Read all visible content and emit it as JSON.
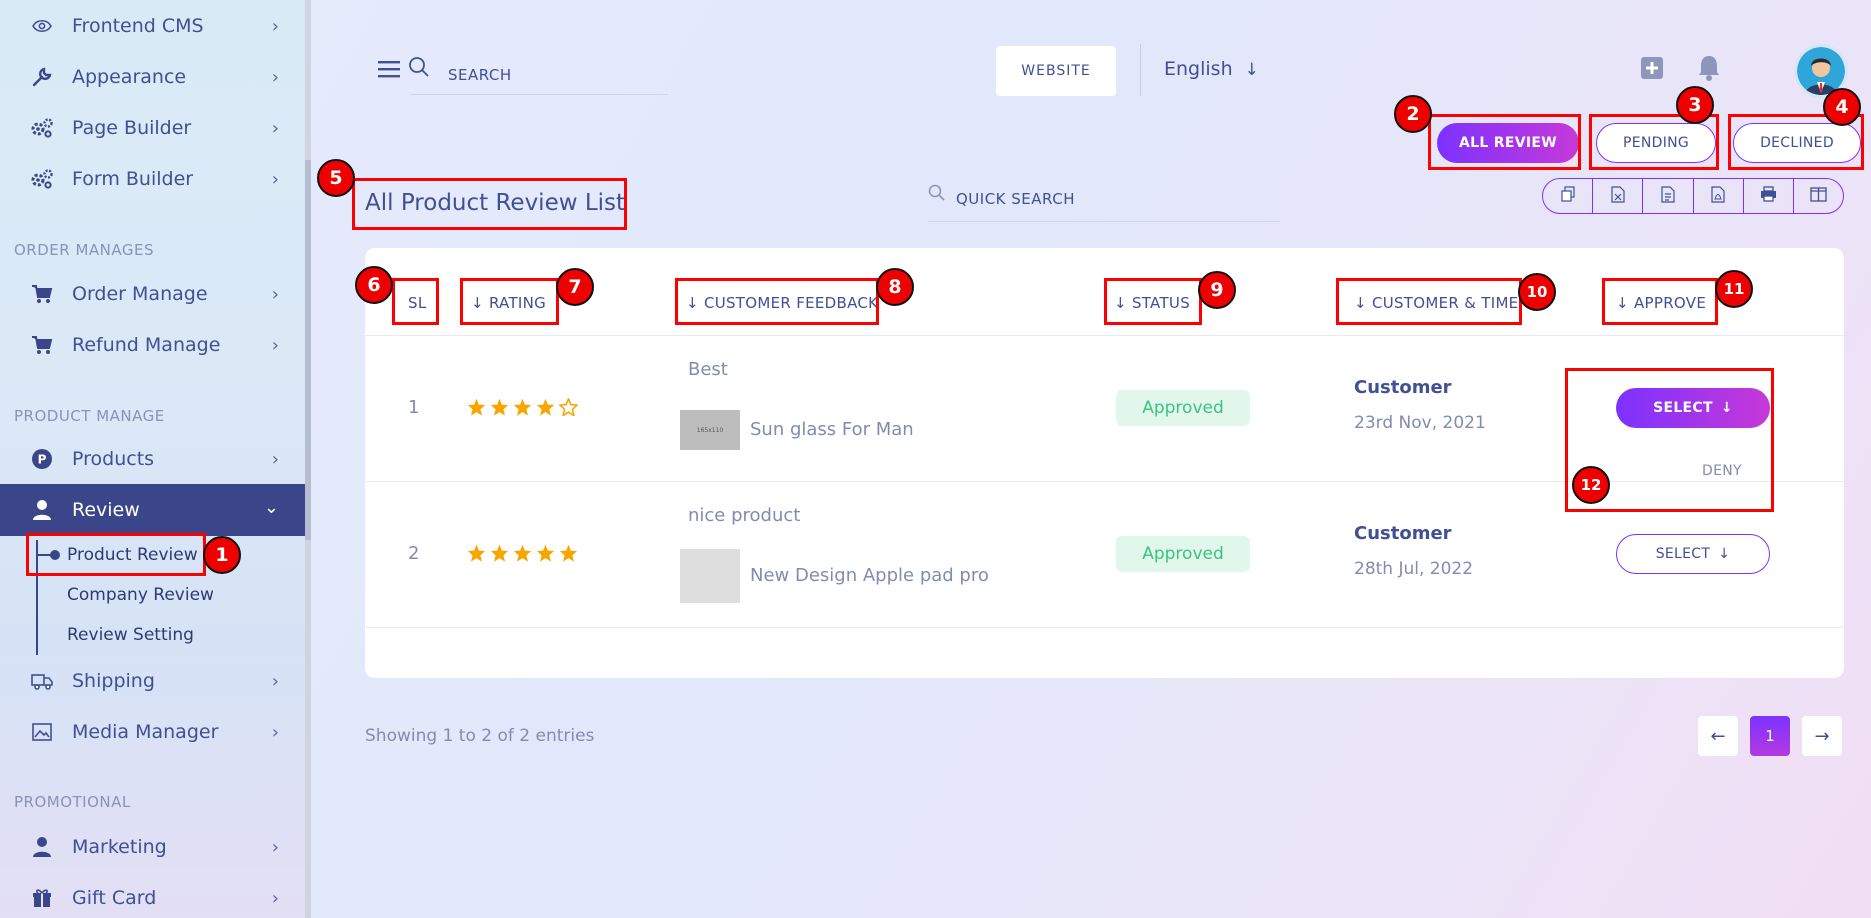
{
  "sidebar": {
    "items": [
      {
        "label": "Frontend CMS",
        "icon": "eye-icon"
      },
      {
        "label": "Appearance",
        "icon": "wrench-icon"
      },
      {
        "label": "Page Builder",
        "icon": "gears-icon"
      },
      {
        "label": "Form Builder",
        "icon": "gears-icon"
      },
      {
        "label": "Order Manage",
        "icon": "cart-icon"
      },
      {
        "label": "Refund Manage",
        "icon": "cart-icon"
      },
      {
        "label": "Products",
        "icon": "product-icon"
      },
      {
        "label": "Review",
        "icon": "user-icon"
      },
      {
        "label": "Shipping",
        "icon": "truck-icon"
      },
      {
        "label": "Media Manager",
        "icon": "image-icon"
      },
      {
        "label": "Marketing",
        "icon": "user-icon"
      },
      {
        "label": "Gift Card",
        "icon": "gift-icon"
      }
    ],
    "sections": {
      "order": "ORDER MANAGES",
      "product": "PRODUCT MANAGE",
      "promotional": "PROMOTIONAL"
    },
    "review_sub": [
      "Product Review",
      "Company Review",
      "Review Setting"
    ]
  },
  "header": {
    "search_placeholder": "SEARCH",
    "website_label": "WEBSITE",
    "language": "English"
  },
  "filters": {
    "all": "ALL REVIEW",
    "pending": "PENDING",
    "declined": "DECLINED"
  },
  "page": {
    "title": "All Product Review List",
    "quick_search_placeholder": "QUICK SEARCH"
  },
  "table": {
    "columns": [
      "SL",
      "RATING",
      "CUSTOMER FEEDBACK",
      "STATUS",
      "CUSTOMER & TIME",
      "APPROVE"
    ],
    "rows": [
      {
        "sl": "1",
        "rating": 4,
        "feedback": "Best",
        "product": "Sun glass For Man",
        "thumb_text": "165x110",
        "status": "Approved",
        "customer": "Customer",
        "time": "23rd Nov, 2021",
        "action": "SELECT"
      },
      {
        "sl": "2",
        "rating": 5,
        "feedback": "nice product",
        "product": "New Design Apple pad pro",
        "thumb_text": "",
        "status": "Approved",
        "customer": "Customer",
        "time": "28th Jul, 2022",
        "action": "SELECT"
      }
    ],
    "dropdown_option": "DENY"
  },
  "footer": {
    "entries": "Showing 1 to 2 of 2 entries",
    "page": "1"
  },
  "markers": [
    "1",
    "2",
    "3",
    "4",
    "5",
    "6",
    "7",
    "8",
    "9",
    "10",
    "11",
    "12"
  ],
  "colors": {
    "accent": "#7c32ff",
    "accent2": "#c738d8",
    "sidebar_active": "#3a4689",
    "annotation": "#ee0000",
    "star": "#f7a600",
    "approved": "#3cc381"
  }
}
